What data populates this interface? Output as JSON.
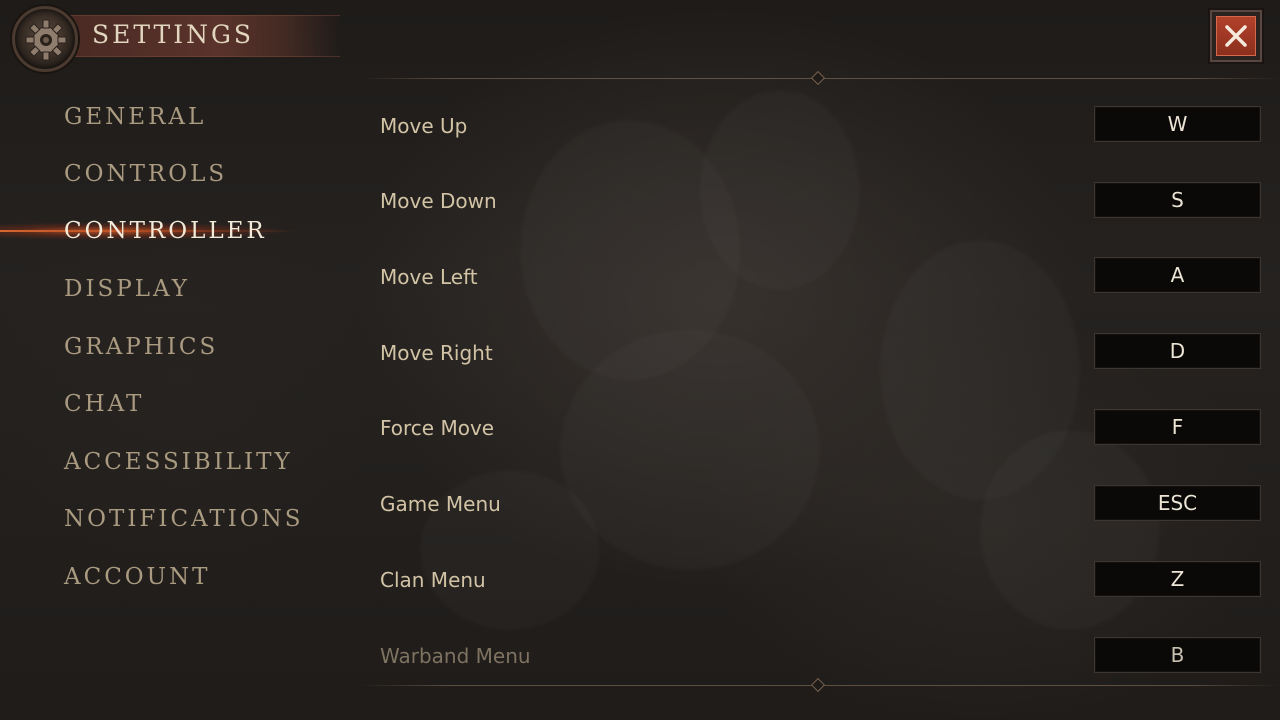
{
  "header": {
    "title": "SETTINGS",
    "settings_icon": "gear-icon",
    "close_icon": "close-icon"
  },
  "sidebar": {
    "items": [
      {
        "label": "GENERAL",
        "active": false
      },
      {
        "label": "CONTROLS",
        "active": false
      },
      {
        "label": "CONTROLLER",
        "active": true
      },
      {
        "label": "DISPLAY",
        "active": false
      },
      {
        "label": "GRAPHICS",
        "active": false
      },
      {
        "label": "CHAT",
        "active": false
      },
      {
        "label": "ACCESSIBILITY",
        "active": false
      },
      {
        "label": "NOTIFICATIONS",
        "active": false
      },
      {
        "label": "ACCOUNT",
        "active": false
      }
    ]
  },
  "bindings": [
    {
      "action": "Move Up",
      "key": "W"
    },
    {
      "action": "Move Down",
      "key": "S"
    },
    {
      "action": "Move Left",
      "key": "A"
    },
    {
      "action": "Move Right",
      "key": "D"
    },
    {
      "action": "Force Move",
      "key": "F"
    },
    {
      "action": "Game Menu",
      "key": "ESC"
    },
    {
      "action": "Clan Menu",
      "key": "Z"
    },
    {
      "action": "Warband Menu",
      "key": "B"
    }
  ],
  "colors": {
    "accent_glow": "#dc5a28",
    "close_button": "#b2412a",
    "active_nav": "#f2ead9",
    "inactive_nav": "#a99a80"
  }
}
